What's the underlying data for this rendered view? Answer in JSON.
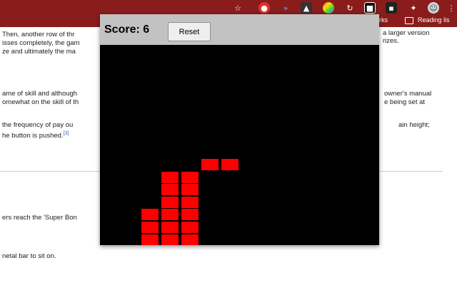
{
  "browser": {
    "bookmarks_partial": "rks",
    "reading_list": "Reading lis"
  },
  "article": {
    "p1": [
      "Then, another row of thr",
      "isses completely, the gam",
      "ze and ultimately the ma"
    ],
    "p1_right": [
      "a larger version",
      "rizes."
    ],
    "p2": [
      "ame of skill and although",
      "omewhat on the skill of th",
      "the frequency of pay ou",
      "he button is pushed."
    ],
    "cite": "[3]",
    "p2_right": [
      "owner's manual",
      "e being set at",
      "ain height;"
    ],
    "p3": "ers reach the 'Super Bon",
    "p4": "netal bar to sit on."
  },
  "game": {
    "score_label": "Score:",
    "score_value": 6,
    "score_text": "Score: 6",
    "reset_label": "Reset",
    "block_color": "#ff0000",
    "board_color": "#000000",
    "blocks": [
      {
        "col": 5,
        "row": 10
      },
      {
        "col": 6,
        "row": 10
      },
      {
        "col": 3,
        "row": 11
      },
      {
        "col": 4,
        "row": 11
      },
      {
        "col": 3,
        "row": 12
      },
      {
        "col": 4,
        "row": 12
      },
      {
        "col": 3,
        "row": 13
      },
      {
        "col": 4,
        "row": 13
      },
      {
        "col": 2,
        "row": 14
      },
      {
        "col": 3,
        "row": 14
      },
      {
        "col": 4,
        "row": 14
      },
      {
        "col": 2,
        "row": 15
      },
      {
        "col": 3,
        "row": 15
      },
      {
        "col": 4,
        "row": 15
      },
      {
        "col": 2,
        "row": 16
      },
      {
        "col": 3,
        "row": 16
      },
      {
        "col": 4,
        "row": 16
      }
    ]
  }
}
